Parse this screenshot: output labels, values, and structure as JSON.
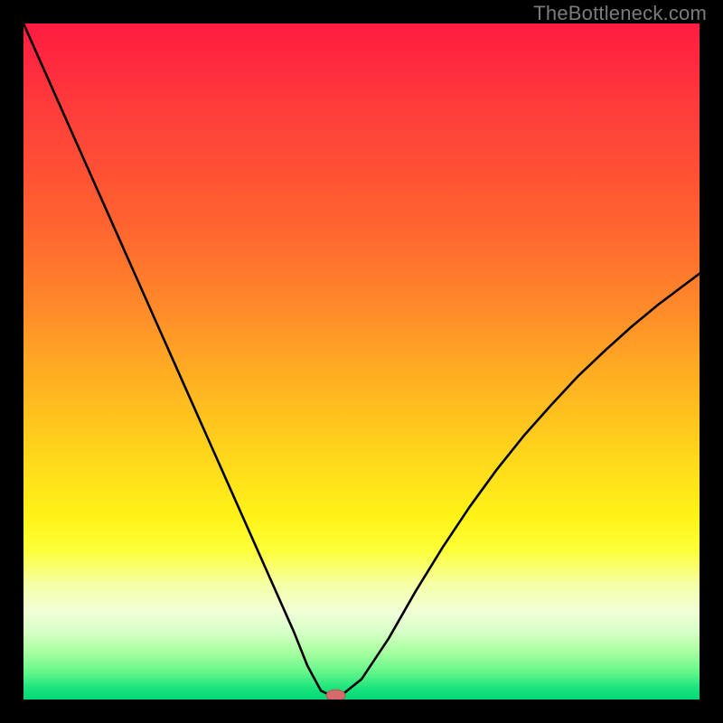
{
  "watermark": "TheBottleneck.com",
  "chart_data": {
    "type": "line",
    "title": "",
    "xlabel": "",
    "ylabel": "",
    "xlim": [
      0,
      100
    ],
    "ylim": [
      0,
      100
    ],
    "grid": false,
    "legend": false,
    "background_gradient": {
      "direction": "vertical",
      "stops": [
        {
          "pos": 0.0,
          "color": "#ff1c42"
        },
        {
          "pos": 0.5,
          "color": "#ffa724"
        },
        {
          "pos": 0.78,
          "color": "#fdff3a"
        },
        {
          "pos": 0.9,
          "color": "#d7ffc8"
        },
        {
          "pos": 1.0,
          "color": "#05d877"
        }
      ]
    },
    "series": [
      {
        "name": "bottleneck-curve",
        "color": "#000000",
        "x": [
          0,
          4,
          8,
          12,
          16,
          20,
          24,
          28,
          32,
          36,
          40,
          42,
          44,
          45.5,
          47,
          50,
          54,
          58,
          62,
          66,
          70,
          74,
          78,
          82,
          86,
          90,
          94,
          98,
          100
        ],
        "y": [
          100,
          91,
          82,
          73,
          64,
          55,
          46,
          37,
          28,
          19,
          10,
          5,
          1.3,
          0.6,
          0.6,
          3,
          9,
          16,
          22.5,
          28.5,
          34,
          39,
          43.5,
          47.8,
          51.6,
          55.2,
          58.5,
          61.5,
          63
        ]
      }
    ],
    "marker": {
      "name": "optimum-point",
      "x": 46.2,
      "y": 0.6,
      "color": "#d46a6a",
      "shape": "ellipse",
      "rx": 1.4,
      "ry": 0.85
    }
  }
}
